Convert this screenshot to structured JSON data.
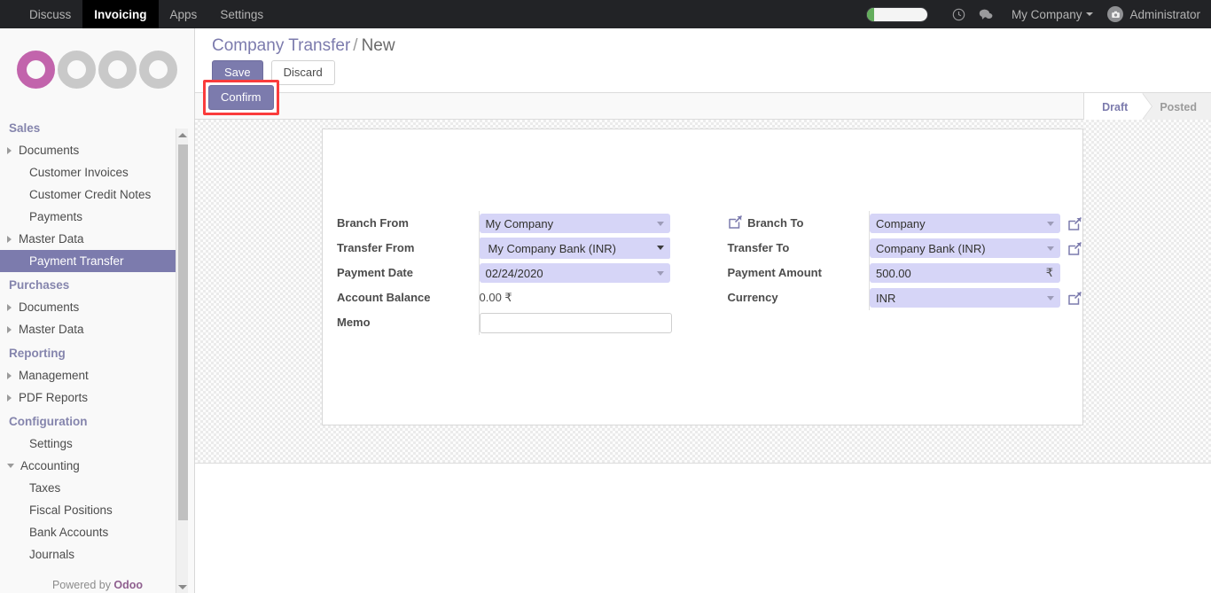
{
  "navbar": {
    "menus": [
      {
        "label": "Discuss",
        "active": false
      },
      {
        "label": "Invoicing",
        "active": true
      },
      {
        "label": "Apps",
        "active": false
      },
      {
        "label": "Settings",
        "active": false
      }
    ],
    "progress_indicator": {
      "name": "loading-progress-bar",
      "fill_color": "#63ad5c",
      "track_color": "#f4f4f4"
    },
    "clock_icon": "clock-icon",
    "chat_icon": "chat-bubble-icon",
    "company": "My Company",
    "user": "Administrator",
    "avatar_icon": "camera-avatar-icon"
  },
  "sidebar": {
    "logo_text": "odoo",
    "logo_accent": "#c264ac",
    "menu": [
      {
        "type": "section",
        "label": "Sales"
      },
      {
        "type": "toggle",
        "label": "Documents",
        "expanded": false
      },
      {
        "type": "child",
        "label": "Customer Invoices"
      },
      {
        "type": "child",
        "label": "Customer Credit Notes"
      },
      {
        "type": "child",
        "label": "Payments"
      },
      {
        "type": "toggle",
        "label": "Master Data",
        "expanded": false
      },
      {
        "type": "child",
        "label": "Payment Transfer",
        "selected": true
      },
      {
        "type": "section",
        "label": "Purchases"
      },
      {
        "type": "toggle",
        "label": "Documents",
        "expanded": false
      },
      {
        "type": "toggle",
        "label": "Master Data",
        "expanded": false
      },
      {
        "type": "section",
        "label": "Reporting"
      },
      {
        "type": "toggle",
        "label": "Management",
        "expanded": false
      },
      {
        "type": "toggle",
        "label": "PDF Reports",
        "expanded": false
      },
      {
        "type": "section",
        "label": "Configuration"
      },
      {
        "type": "child",
        "label": "Settings"
      },
      {
        "type": "toggle",
        "label": "Accounting",
        "expanded": true
      },
      {
        "type": "child",
        "label": "Taxes"
      },
      {
        "type": "child",
        "label": "Fiscal Positions"
      },
      {
        "type": "child",
        "label": "Bank Accounts"
      },
      {
        "type": "child",
        "label": "Journals"
      }
    ],
    "selected_color": "#7c7bad",
    "footer_prefix": "Powered by ",
    "footer_brand": "Odoo"
  },
  "breadcrumb": {
    "parent": "Company Transfer",
    "separator": "/",
    "current": "New"
  },
  "toolbar": {
    "save_label": "Save",
    "discard_label": "Discard"
  },
  "action_bar": {
    "confirm_label": "Confirm",
    "confirm_highlight_color": "#fa3c3c"
  },
  "statusbar": {
    "stages": [
      {
        "label": "Draft",
        "active": true
      },
      {
        "label": "Posted",
        "active": false
      }
    ],
    "active_color": "#7c7bad"
  },
  "form": {
    "left": [
      {
        "label": "Branch From",
        "widget": "many2one",
        "value": "My Company",
        "name": "branch-from-field",
        "external_link": false
      },
      {
        "label": "Transfer From",
        "widget": "select",
        "value": "My Company Bank (INR)",
        "name": "transfer-from-field",
        "external_link": false
      },
      {
        "label": "Payment Date",
        "widget": "date",
        "value": "02/24/2020",
        "name": "payment-date-field",
        "external_link": false
      },
      {
        "label": "Account Balance",
        "widget": "readonly",
        "value": "0.00 ₹",
        "name": "account-balance-value",
        "external_link": false
      },
      {
        "label": "Memo",
        "widget": "text",
        "value": "",
        "placeholder": "",
        "name": "memo-field",
        "external_link": false
      }
    ],
    "right": [
      {
        "label": "Branch To",
        "widget": "many2one",
        "value": "Company",
        "name": "branch-to-field",
        "external_link": true,
        "link_before_label": true
      },
      {
        "label": "Transfer To",
        "widget": "many2one",
        "value": "Company Bank (INR)",
        "name": "transfer-to-field",
        "external_link": true
      },
      {
        "label": "Payment Amount",
        "widget": "monetary",
        "value": "500.00",
        "currency_symbol": "₹",
        "name": "payment-amount-field",
        "external_link": false
      },
      {
        "label": "Currency",
        "widget": "many2one",
        "value": "INR",
        "name": "currency-field",
        "external_link": true
      }
    ]
  }
}
